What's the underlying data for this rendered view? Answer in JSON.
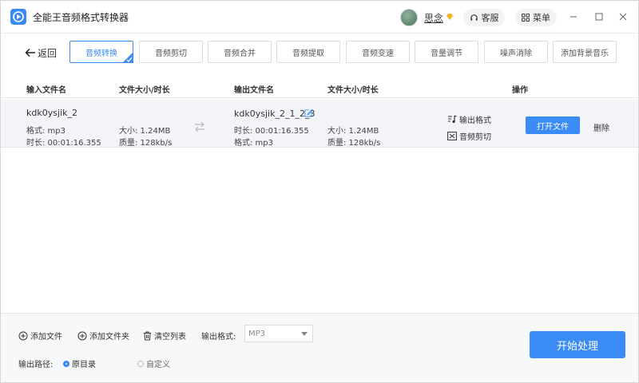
{
  "app": {
    "title": "全能王音频格式转换器"
  },
  "user": {
    "name": "思念"
  },
  "header": {
    "service_label": "客服",
    "menu_label": "菜单"
  },
  "toolbar": {
    "back_label": "返回",
    "tabs": [
      {
        "label": "音频转换",
        "active": true
      },
      {
        "label": "音频剪切",
        "active": false
      },
      {
        "label": "音频合并",
        "active": false
      },
      {
        "label": "音频提取",
        "active": false
      },
      {
        "label": "音频变速",
        "active": false
      },
      {
        "label": "音量调节",
        "active": false
      },
      {
        "label": "噪声消除",
        "active": false
      },
      {
        "label": "添加背景音乐",
        "active": false
      }
    ]
  },
  "table": {
    "headers": {
      "input_name": "输入文件名",
      "input_size": "文件大小/时长",
      "output_name": "输出文件名",
      "output_size": "文件大小/时长",
      "actions": "操作"
    },
    "rows": [
      {
        "input_name": "kdk0ysjik_2",
        "input_format": "格式: mp3",
        "input_duration": "时长: 00:01:16.355",
        "input_size": "大小: 1.24MB",
        "input_quality": "质量: 128kb/s",
        "output_name": "kdk0ysjik_2_1_2_3",
        "output_duration": "时长: 00:01:16.355",
        "output_format": "格式: mp3",
        "output_size": "大小: 1.24MB",
        "output_quality": "质量: 128kb/s",
        "output_format_action": "输出格式",
        "audio_cut_action": "音频剪切",
        "open_file_label": "打开文件",
        "delete_label": "删除"
      }
    ]
  },
  "bottom": {
    "add_file_label": "添加文件",
    "add_folder_label": "添加文件夹",
    "clear_list_label": "清空列表",
    "output_format_label": "输出格式:",
    "output_format_value": "MP3",
    "output_path_label": "输出路径:",
    "path_original_label": "原目录",
    "path_custom_label": "自定义",
    "path_selected": "原目录",
    "start_label": "开始处理"
  },
  "colors": {
    "accent": "#3a8bf5"
  }
}
